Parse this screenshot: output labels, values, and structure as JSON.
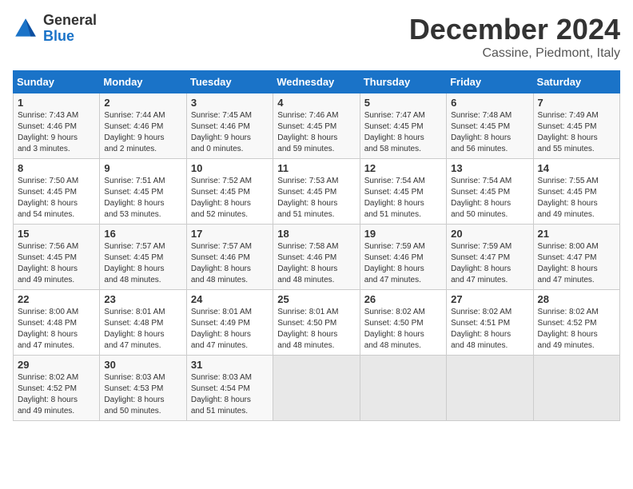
{
  "header": {
    "logo_general": "General",
    "logo_blue": "Blue",
    "month": "December 2024",
    "location": "Cassine, Piedmont, Italy"
  },
  "days_of_week": [
    "Sunday",
    "Monday",
    "Tuesday",
    "Wednesday",
    "Thursday",
    "Friday",
    "Saturday"
  ],
  "weeks": [
    [
      {
        "day": "1",
        "info": "Sunrise: 7:43 AM\nSunset: 4:46 PM\nDaylight: 9 hours\nand 3 minutes."
      },
      {
        "day": "2",
        "info": "Sunrise: 7:44 AM\nSunset: 4:46 PM\nDaylight: 9 hours\nand 2 minutes."
      },
      {
        "day": "3",
        "info": "Sunrise: 7:45 AM\nSunset: 4:46 PM\nDaylight: 9 hours\nand 0 minutes."
      },
      {
        "day": "4",
        "info": "Sunrise: 7:46 AM\nSunset: 4:45 PM\nDaylight: 8 hours\nand 59 minutes."
      },
      {
        "day": "5",
        "info": "Sunrise: 7:47 AM\nSunset: 4:45 PM\nDaylight: 8 hours\nand 58 minutes."
      },
      {
        "day": "6",
        "info": "Sunrise: 7:48 AM\nSunset: 4:45 PM\nDaylight: 8 hours\nand 56 minutes."
      },
      {
        "day": "7",
        "info": "Sunrise: 7:49 AM\nSunset: 4:45 PM\nDaylight: 8 hours\nand 55 minutes."
      }
    ],
    [
      {
        "day": "8",
        "info": "Sunrise: 7:50 AM\nSunset: 4:45 PM\nDaylight: 8 hours\nand 54 minutes."
      },
      {
        "day": "9",
        "info": "Sunrise: 7:51 AM\nSunset: 4:45 PM\nDaylight: 8 hours\nand 53 minutes."
      },
      {
        "day": "10",
        "info": "Sunrise: 7:52 AM\nSunset: 4:45 PM\nDaylight: 8 hours\nand 52 minutes."
      },
      {
        "day": "11",
        "info": "Sunrise: 7:53 AM\nSunset: 4:45 PM\nDaylight: 8 hours\nand 51 minutes."
      },
      {
        "day": "12",
        "info": "Sunrise: 7:54 AM\nSunset: 4:45 PM\nDaylight: 8 hours\nand 51 minutes."
      },
      {
        "day": "13",
        "info": "Sunrise: 7:54 AM\nSunset: 4:45 PM\nDaylight: 8 hours\nand 50 minutes."
      },
      {
        "day": "14",
        "info": "Sunrise: 7:55 AM\nSunset: 4:45 PM\nDaylight: 8 hours\nand 49 minutes."
      }
    ],
    [
      {
        "day": "15",
        "info": "Sunrise: 7:56 AM\nSunset: 4:45 PM\nDaylight: 8 hours\nand 49 minutes."
      },
      {
        "day": "16",
        "info": "Sunrise: 7:57 AM\nSunset: 4:45 PM\nDaylight: 8 hours\nand 48 minutes."
      },
      {
        "day": "17",
        "info": "Sunrise: 7:57 AM\nSunset: 4:46 PM\nDaylight: 8 hours\nand 48 minutes."
      },
      {
        "day": "18",
        "info": "Sunrise: 7:58 AM\nSunset: 4:46 PM\nDaylight: 8 hours\nand 48 minutes."
      },
      {
        "day": "19",
        "info": "Sunrise: 7:59 AM\nSunset: 4:46 PM\nDaylight: 8 hours\nand 47 minutes."
      },
      {
        "day": "20",
        "info": "Sunrise: 7:59 AM\nSunset: 4:47 PM\nDaylight: 8 hours\nand 47 minutes."
      },
      {
        "day": "21",
        "info": "Sunrise: 8:00 AM\nSunset: 4:47 PM\nDaylight: 8 hours\nand 47 minutes."
      }
    ],
    [
      {
        "day": "22",
        "info": "Sunrise: 8:00 AM\nSunset: 4:48 PM\nDaylight: 8 hours\nand 47 minutes."
      },
      {
        "day": "23",
        "info": "Sunrise: 8:01 AM\nSunset: 4:48 PM\nDaylight: 8 hours\nand 47 minutes."
      },
      {
        "day": "24",
        "info": "Sunrise: 8:01 AM\nSunset: 4:49 PM\nDaylight: 8 hours\nand 47 minutes."
      },
      {
        "day": "25",
        "info": "Sunrise: 8:01 AM\nSunset: 4:50 PM\nDaylight: 8 hours\nand 48 minutes."
      },
      {
        "day": "26",
        "info": "Sunrise: 8:02 AM\nSunset: 4:50 PM\nDaylight: 8 hours\nand 48 minutes."
      },
      {
        "day": "27",
        "info": "Sunrise: 8:02 AM\nSunset: 4:51 PM\nDaylight: 8 hours\nand 48 minutes."
      },
      {
        "day": "28",
        "info": "Sunrise: 8:02 AM\nSunset: 4:52 PM\nDaylight: 8 hours\nand 49 minutes."
      }
    ],
    [
      {
        "day": "29",
        "info": "Sunrise: 8:02 AM\nSunset: 4:52 PM\nDaylight: 8 hours\nand 49 minutes."
      },
      {
        "day": "30",
        "info": "Sunrise: 8:03 AM\nSunset: 4:53 PM\nDaylight: 8 hours\nand 50 minutes."
      },
      {
        "day": "31",
        "info": "Sunrise: 8:03 AM\nSunset: 4:54 PM\nDaylight: 8 hours\nand 51 minutes."
      },
      {
        "day": "",
        "info": ""
      },
      {
        "day": "",
        "info": ""
      },
      {
        "day": "",
        "info": ""
      },
      {
        "day": "",
        "info": ""
      }
    ]
  ]
}
